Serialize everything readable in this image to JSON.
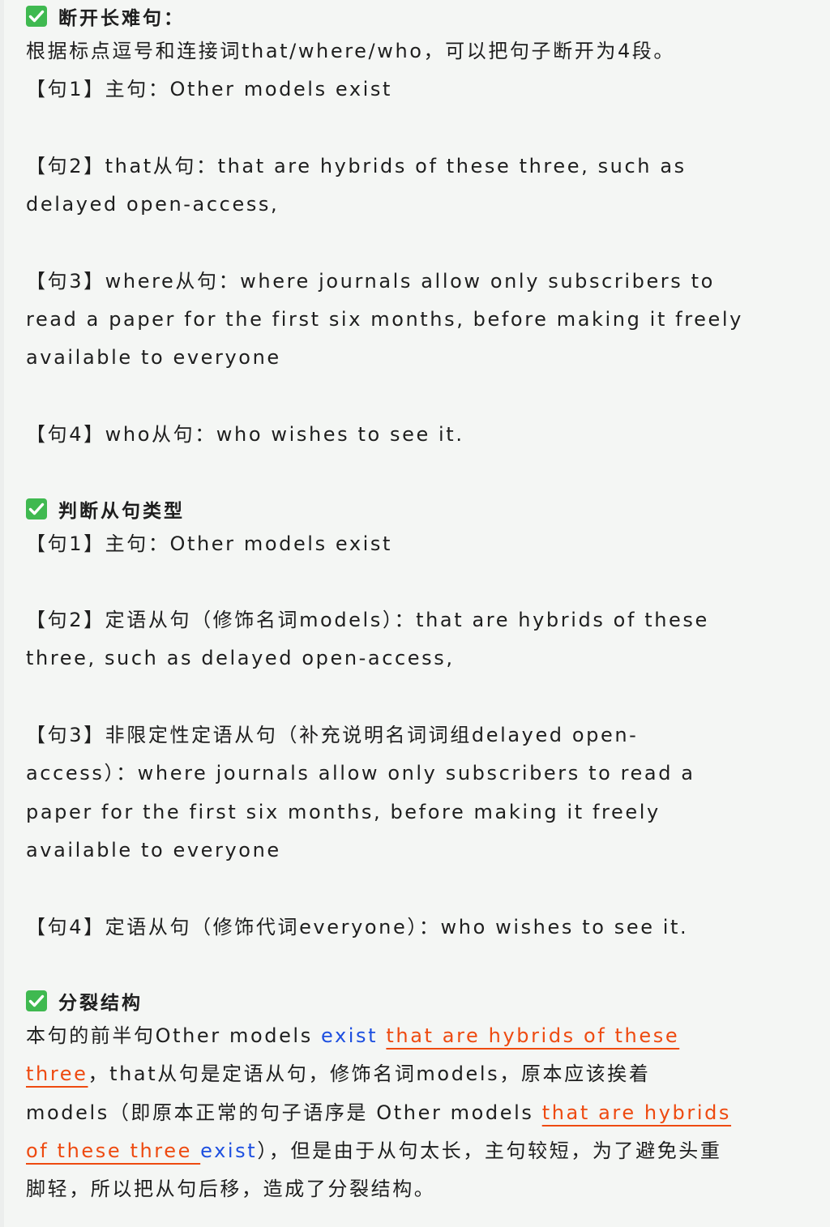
{
  "sections": [
    {
      "title": "断开长难句：",
      "intro": "根据标点逗号和连接词that/where/who，可以把句子断开为4段。",
      "s1": "【句1】主句：Other models exist",
      "s2_l1": "【句2】that从句：that are hybrids of these three, such as",
      "s2_l2": "delayed open-access,",
      "s3_l1": "【句3】where从句：where journals allow only subscribers to",
      "s3_l2": "read a paper for the first six months, before making it freely",
      "s3_l3": "available to everyone",
      "s4": "【句4】who从句：who wishes to see it."
    },
    {
      "title": "判断从句类型",
      "s1": "【句1】主句：Other models exist",
      "s2_l1": "【句2】定语从句（修饰名词models）：that are hybrids of these",
      "s2_l2": "three, such as delayed open-access,",
      "s3_l1": "【句3】非限定性定语从句（补充说明名词词组delayed open-",
      "s3_l2": "access）：where journals allow only subscribers to read a",
      "s3_l3": "paper for the first six months, before making it freely",
      "s3_l4": "available to everyone",
      "s4": "【句4】定语从句（修饰代词everyone）：who wishes to see it."
    },
    {
      "title": "分裂结构",
      "p1_a": "本句的前半句Other models ",
      "p1_exist": "exist",
      "p1_red": "that are hybrids of these",
      "p2_red": "three",
      "p2_b": "，that从句是定语从句，修饰名词models，原本应该挨着",
      "p3_a": "models（即原本正常的句子语序是 Other models ",
      "p3_red": "that are hybrids",
      "p4_red": "of these three ",
      "p4_exist": "exist",
      "p4_b": "），但是由于从句太长，主句较短，为了避免头重",
      "p5": "脚轻，所以把从句后移，造成了分裂结构。"
    }
  ],
  "colors": {
    "check_green": "#3fb950",
    "highlight_blue": "#1d4fe0",
    "highlight_red": "#ee4a10"
  },
  "icons": {
    "section_marker": "check-mark-icon"
  }
}
